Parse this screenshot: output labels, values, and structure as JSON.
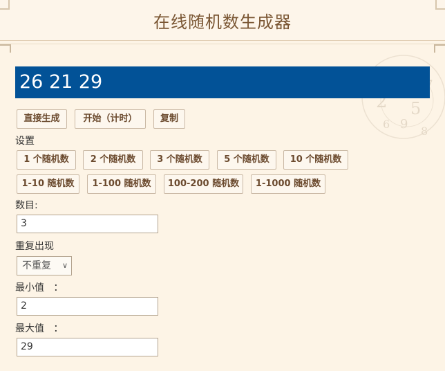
{
  "header": {
    "title": "在线随机数生成器"
  },
  "result": {
    "value": "26 21 29"
  },
  "actions": {
    "generate_label": "直接生成",
    "start_label": "开始（计时）",
    "copy_label": "复制"
  },
  "settings": {
    "title": "设置",
    "presets": [
      "1 个随机数",
      "2 个随机数",
      "3 个随机数",
      "5 个随机数",
      "10 个随机数",
      "1-10 随机数",
      "1-100 随机数",
      "100-200 随机数",
      "1-1000 随机数"
    ]
  },
  "form": {
    "count_label": "数目:",
    "count_value": "3",
    "repeat_label": "重复出现",
    "repeat_selected": "不重复",
    "min_label": "最小值   ：",
    "min_value": "2",
    "max_label": "最大值   ：",
    "max_value": "29"
  },
  "colors": {
    "accent": "#025297",
    "background": "#fdf4e6",
    "title": "#7a5633"
  }
}
